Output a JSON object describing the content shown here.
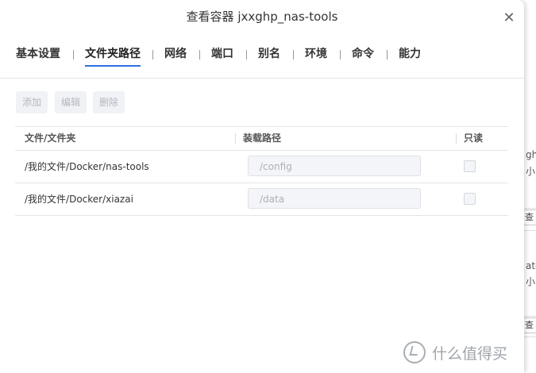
{
  "dialog": {
    "title": "查看容器 jxxghp_nas-tools",
    "close_glyph": "✕"
  },
  "tabs": [
    {
      "label": "基本设置",
      "active": false
    },
    {
      "label": "文件夹路径",
      "active": true
    },
    {
      "label": "网络",
      "active": false
    },
    {
      "label": "端口",
      "active": false
    },
    {
      "label": "别名",
      "active": false
    },
    {
      "label": "环境",
      "active": false
    },
    {
      "label": "命令",
      "active": false
    },
    {
      "label": "能力",
      "active": false
    }
  ],
  "toolbar": {
    "add_label": "添加",
    "edit_label": "编辑",
    "delete_label": "删除"
  },
  "table": {
    "headers": {
      "path": "文件/文件夹",
      "mount": "装载路径",
      "readonly": "只读"
    },
    "rows": [
      {
        "path": "/我的文件/Docker/nas-tools",
        "mount": "/config",
        "readonly": false
      },
      {
        "path": "/我的文件/Docker/xiazai",
        "mount": "/data",
        "readonly": false
      }
    ]
  },
  "background": {
    "frag1": "ght",
    "frag2": "小",
    "btn1": "查多",
    "frag3": "ate",
    "frag4": "小",
    "btn2": "查多"
  },
  "watermark": {
    "text": "什么值得买",
    "icon": "zhide-logo-icon"
  },
  "colors": {
    "accent": "#2f6fe4"
  }
}
